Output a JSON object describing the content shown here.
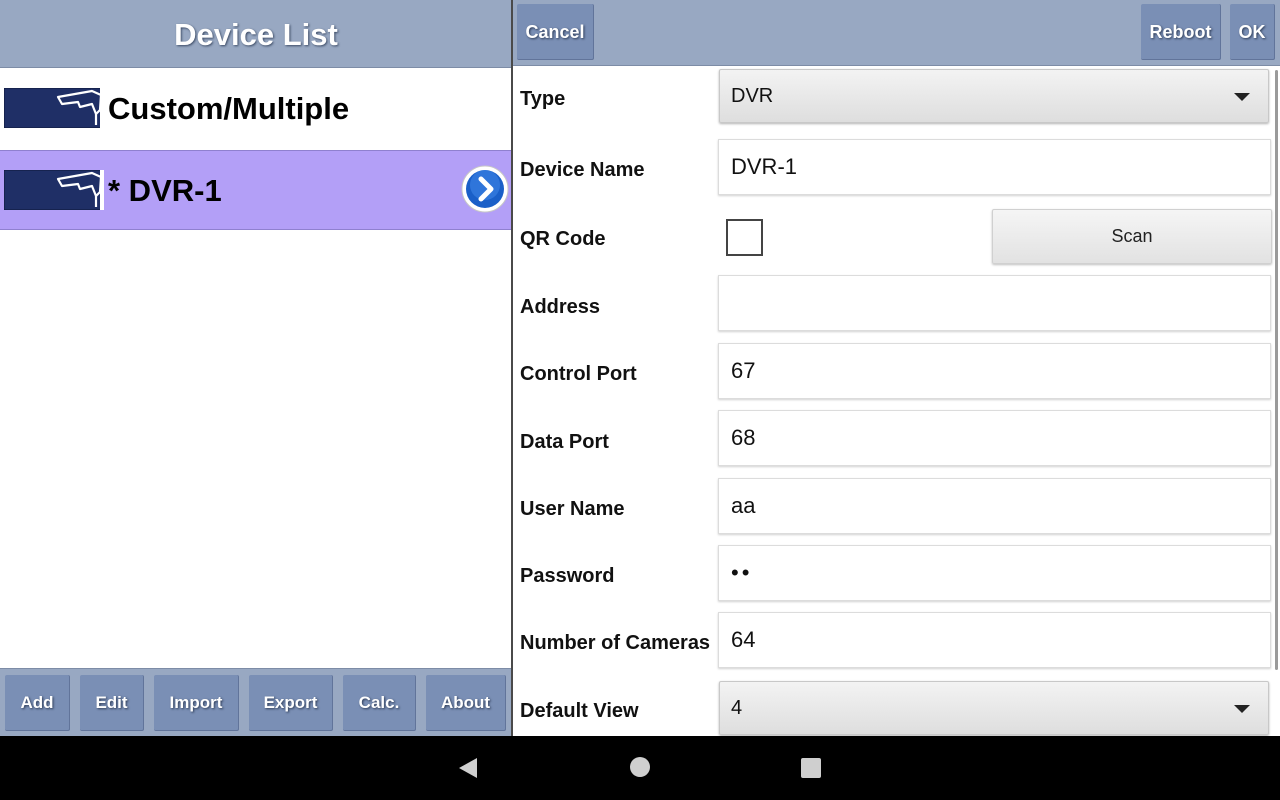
{
  "left": {
    "title": "Device List",
    "devices": [
      {
        "label": "Custom/Multiple",
        "selected": false
      },
      {
        "label": "* DVR-1",
        "selected": true
      }
    ],
    "toolbar": {
      "add": "Add",
      "edit": "Edit",
      "import": "Import",
      "export": "Export",
      "calc": "Calc.",
      "about": "About"
    }
  },
  "right": {
    "header": {
      "cancel": "Cancel",
      "reboot": "Reboot",
      "ok": "OK"
    },
    "form": {
      "type": {
        "label": "Type",
        "value": "DVR"
      },
      "device_name": {
        "label": "Device Name",
        "value": "DVR-1"
      },
      "qr_code": {
        "label": "QR Code",
        "checked": false,
        "scan_label": "Scan"
      },
      "address": {
        "label": "Address",
        "value": ""
      },
      "control_port": {
        "label": "Control Port",
        "value": "67"
      },
      "data_port": {
        "label": "Data Port",
        "value": "68"
      },
      "user_name": {
        "label": "User Name",
        "value": "aa"
      },
      "password": {
        "label": "Password",
        "value": "••"
      },
      "num_cameras": {
        "label": "Number of Cameras",
        "value": "64"
      },
      "default_view": {
        "label": "Default View",
        "value": "4"
      }
    }
  },
  "colors": {
    "header_bg": "#98a8c2",
    "button_bg": "#7a8fb5",
    "selected_row": "#b39ff7",
    "icon_navy": "#1f2f66",
    "chevron_blue": "#1a5fc8"
  },
  "icons": {
    "device": "cctv-camera-icon",
    "row_action": "chevron-right-circle-icon",
    "nav": [
      "back-triangle-icon",
      "home-circle-icon",
      "recent-square-icon"
    ]
  }
}
